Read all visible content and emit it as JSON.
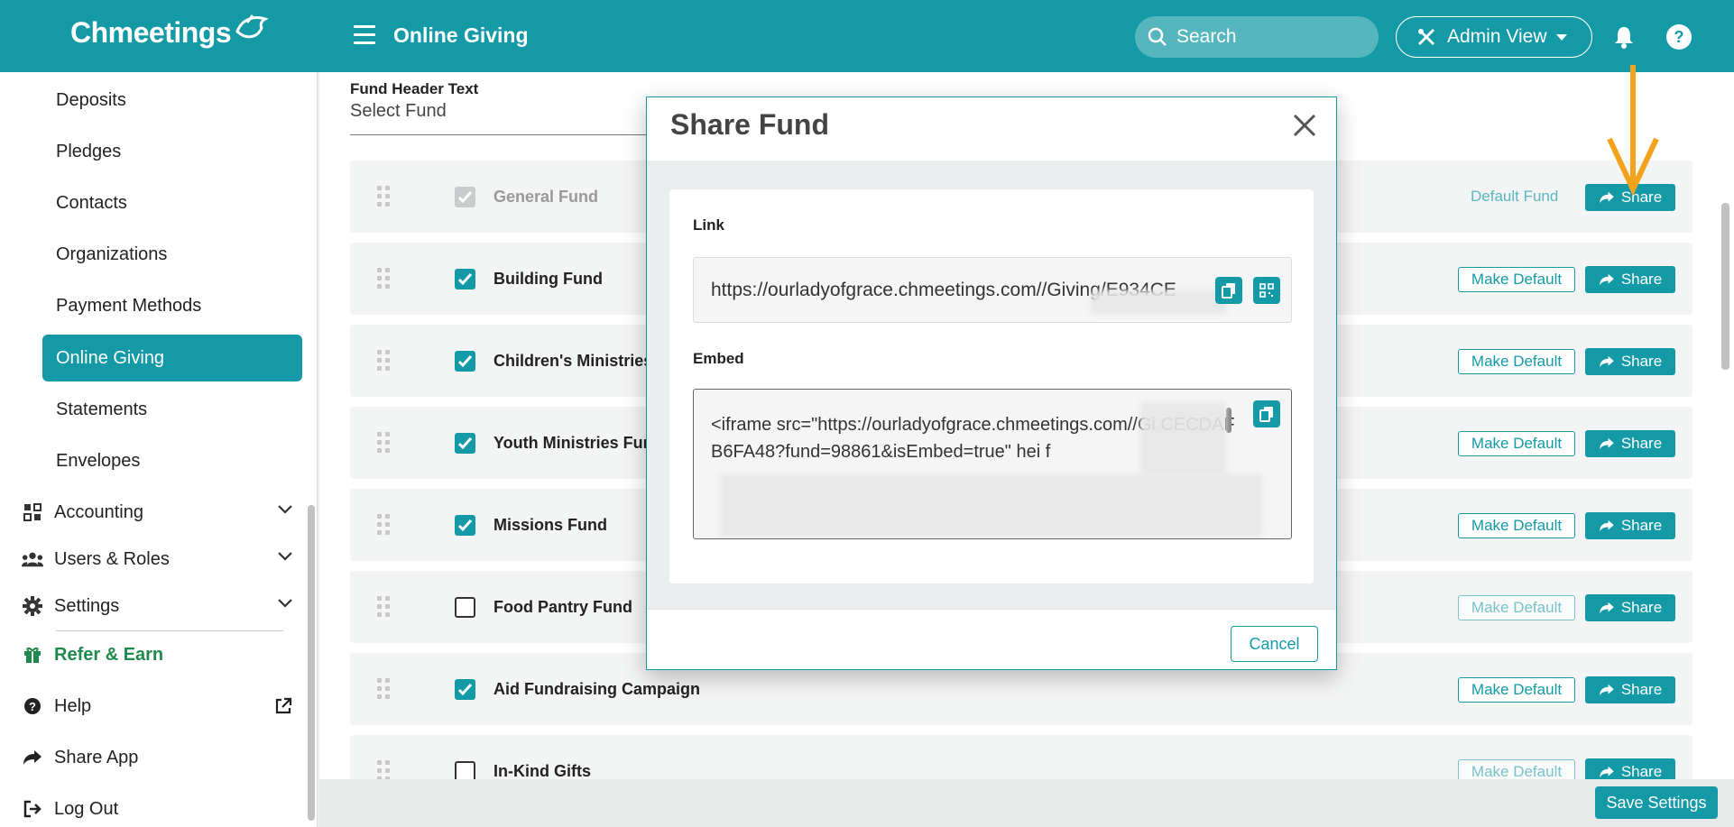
{
  "app": {
    "logo_text": "Chmeetings",
    "page_title": "Online Giving"
  },
  "topbar": {
    "search_placeholder": "Search",
    "admin_view_label": "Admin View"
  },
  "sidebar": {
    "items": [
      {
        "label": "Deposits"
      },
      {
        "label": "Pledges"
      },
      {
        "label": "Contacts"
      },
      {
        "label": "Organizations"
      },
      {
        "label": "Payment Methods"
      },
      {
        "label": "Online Giving",
        "active": true
      },
      {
        "label": "Statements"
      },
      {
        "label": "Envelopes"
      }
    ],
    "sections": [
      {
        "label": "Accounting",
        "icon": "accounting-icon"
      },
      {
        "label": "Users & Roles",
        "icon": "users-icon"
      },
      {
        "label": "Settings",
        "icon": "gear-icon"
      }
    ],
    "refer": "Refer & Earn",
    "help": "Help",
    "share_app": "Share App",
    "logout": "Log Out"
  },
  "main": {
    "fund_header_label": "Fund Header Text",
    "fund_select_value": "Select Fund",
    "default_fund_label": "Default Fund",
    "make_default_label": "Make Default",
    "share_label": "Share",
    "save_settings": "Save Settings",
    "funds": [
      {
        "name": "General Fund",
        "checked": true,
        "disabled": true,
        "is_default": true
      },
      {
        "name": "Building Fund",
        "checked": true
      },
      {
        "name": "Children's Ministries",
        "checked": true
      },
      {
        "name": "Youth Ministries Fun",
        "checked": true
      },
      {
        "name": "Missions Fund",
        "checked": true
      },
      {
        "name": "Food Pantry Fund",
        "checked": false
      },
      {
        "name": "Aid Fundraising Campaign",
        "checked": true
      },
      {
        "name": "In-Kind Gifts",
        "checked": false
      }
    ]
  },
  "modal": {
    "title": "Share Fund",
    "link_label": "Link",
    "link_value": "https://ourladyofgrace.chmeetings.com//Giving/E934CE",
    "embed_label": "Embed",
    "embed_value": "<iframe src=\"https://ourladyofgrace.chmeetings.com//Gi CECDAFB6FA48?fund=98861&isEmbed=true\" hei f",
    "cancel_label": "Cancel"
  },
  "colors": {
    "brand": "#149aa6",
    "refer": "#1f8a4c",
    "annotation": "#f2a21b"
  }
}
